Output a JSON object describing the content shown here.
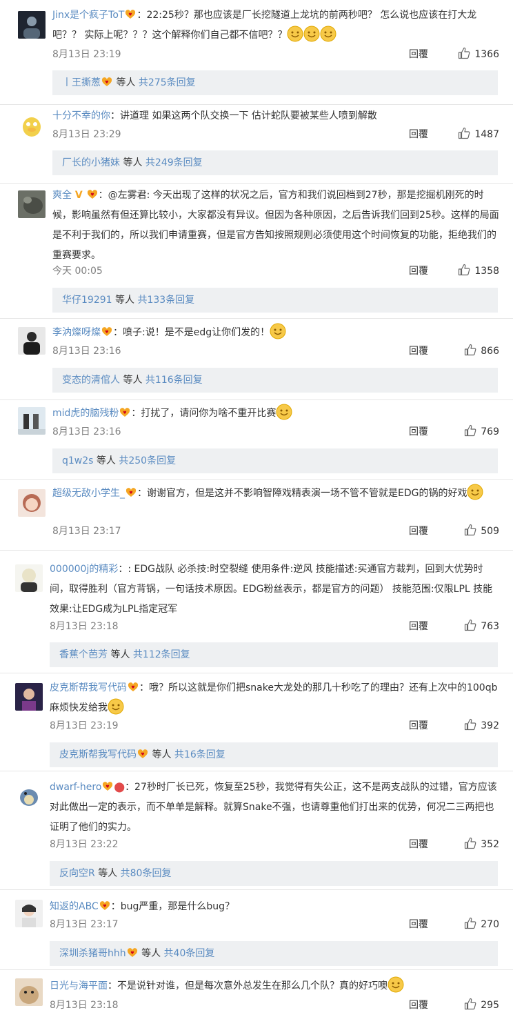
{
  "reply_label": "回覆",
  "reply_summary": {
    "etc": "等人",
    "prefix": "共",
    "suffix": "条回复"
  },
  "comments": [
    {
      "username": "Jinx是个疯子ToT",
      "text": "：22:25秒？那也应该是厂长挖隧道上龙坑的前两秒吧？ 怎么说也应该在打大龙吧？？ 实际上呢？？？这个解释你们自己都不信吧？？",
      "time": "8月13日 23:19",
      "likes": "1366",
      "reply_user": "丨王撕葱",
      "reply_count": "275"
    },
    {
      "username": "十分不幸的你",
      "text": "：讲道理 如果这两个队交换一下 估计蛇队要被某些人喷到解散",
      "time": "8月13日 23:29",
      "likes": "1487",
      "reply_user": "厂长的小猪妹",
      "reply_count": "249"
    },
    {
      "username": "爽全",
      "text": "：@左雾君: 今天出现了这样的状况之后，官方和我们说回档到27秒，那是挖掘机刚死的时候，影响虽然有但还算比较小，大家都没有异议。但因为各种原因，之后告诉我们回到25秒。这样的局面是不利于我们的，所以我们申请重赛，但是官方告知按照规则必须使用这个时间恢复的功能，拒绝我们的重赛要求。",
      "time": "今天 00:05",
      "likes": "1358",
      "reply_user": "华仔19291",
      "reply_count": "133"
    },
    {
      "username": "李汭燦呀燦",
      "text": "：喷子:说！是不是edg让你们发的！",
      "time": "8月13日 23:16",
      "likes": "866",
      "reply_user": "变态的清倌人",
      "reply_count": "116"
    },
    {
      "username": "mid虎的脑残粉",
      "text": "：打扰了，请问你为啥不重开比赛",
      "time": "8月13日 23:16",
      "likes": "769",
      "reply_user": "q1w2s",
      "reply_count": "250"
    },
    {
      "username": "超级无敌小学生_",
      "text": "：谢谢官方，但是这并不影响智障戏精表演一场不管不管就是EDG的锅的好戏",
      "time": "8月13日 23:17",
      "likes": "509"
    },
    {
      "username": "000000j的精彩",
      "text": "：: EDG战队 必杀技:时空裂缝 使用条件:逆风 技能描述:买通官方裁判，回到大优势时间，取得胜利（官方背锅，一句话技术原因。EDG粉丝表示，都是官方的问题） 技能范围:仅限LPL 技能效果:让EDG成为LPL指定冠军",
      "time": "8月13日 23:18",
      "likes": "763",
      "reply_user": "香蕉个芭芳",
      "reply_count": "112"
    },
    {
      "username": "皮克斯帮我写代码",
      "text": "：哦？所以这就是你们把snake大龙处的那几十秒吃了的理由？还有上次中的100qb麻烦快发给我",
      "time": "8月13日 23:19",
      "likes": "392",
      "reply_user": "皮克斯帮我写代码",
      "reply_count": "16"
    },
    {
      "username": "dwarf-hero",
      "text": "：27秒时厂长已死，恢复至25秒，我觉得有失公正，这不是两支战队的过错，官方应该对此做出一定的表示，而不单单是解释。就算Snake不强，也请尊重他们打出来的优势，何况二三两把也证明了他们的实力。",
      "time": "8月13日 23:22",
      "likes": "352",
      "reply_user": "反向空R",
      "reply_count": "80"
    },
    {
      "username": "知返的ABC",
      "text": "：bug严重，那是什么bug？",
      "time": "8月13日 23:17",
      "likes": "270",
      "reply_user": "深圳杀猪哥hhh",
      "reply_count": "40"
    },
    {
      "username": "日光与海平面",
      "text": "：不是说针对谁，但是每次意外总发生在那么几个队？真的好巧噢",
      "time": "8月13日 23:18",
      "likes": "295"
    }
  ],
  "colors": {
    "username": "#5a8bc1",
    "reply_bg": "#eef0f2",
    "meta": "#808080",
    "badge": "#f5a623"
  },
  "icons": {
    "like": "thumbs-up-icon",
    "vip": "vip-badge-icon",
    "verified": "verified-v-icon"
  }
}
